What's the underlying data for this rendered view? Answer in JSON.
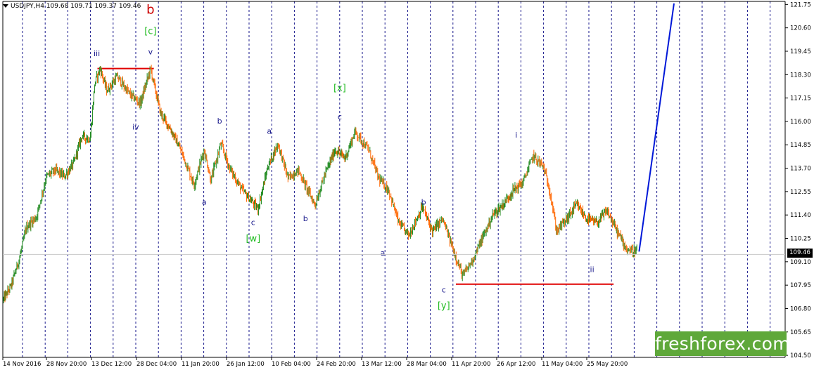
{
  "header": {
    "symbol_info": "USDJPY,H4  109.68 109.71 109.37 109.46"
  },
  "logo": {
    "text": "freshforex.com"
  },
  "current_price_label": "109.46",
  "colors": {
    "bear_candle": "#ff6600",
    "bull_candle": "#228b22",
    "forecast_line": "#0018d8",
    "level_line": "#e00000",
    "wave_blue": "#1a1a8c",
    "wave_green": "#22bb22",
    "wave_red": "#cc0000"
  },
  "chart_data": {
    "type": "candlestick",
    "title": "USDJPY,H4",
    "y_axis": {
      "min": 104.4,
      "max": 121.9,
      "ticks": [
        "121.75",
        "120.60",
        "119.45",
        "118.30",
        "117.15",
        "116.00",
        "114.85",
        "113.70",
        "112.55",
        "111.40",
        "110.25",
        "109.10",
        "107.95",
        "106.80",
        "105.65",
        "104.50"
      ]
    },
    "x_axis": {
      "ticks": [
        "14 Nov 2016",
        "28 Nov 20:00",
        "13 Dec 12:00",
        "28 Dec 04:00",
        "11 Jan 20:00",
        "26 Jan 12:00",
        "10 Feb 04:00",
        "24 Feb 20:00",
        "13 Mar 12:00",
        "28 Mar 04:00",
        "11 Apr 20:00",
        "26 Apr 12:00",
        "11 May 04:00",
        "25 May 20:00"
      ]
    },
    "grid": "vertical dashed",
    "path_points": [
      {
        "t": 0,
        "p": 107.2
      },
      {
        "t": 0.012,
        "p": 107.9
      },
      {
        "t": 0.025,
        "p": 109.3
      },
      {
        "t": 0.035,
        "p": 110.8
      },
      {
        "t": 0.05,
        "p": 111.3
      },
      {
        "t": 0.065,
        "p": 113.3
      },
      {
        "t": 0.078,
        "p": 113.6
      },
      {
        "t": 0.092,
        "p": 113.3
      },
      {
        "t": 0.105,
        "p": 113.9
      },
      {
        "t": 0.118,
        "p": 115.3
      },
      {
        "t": 0.13,
        "p": 115.1
      },
      {
        "t": 0.137,
        "p": 117.9
      },
      {
        "t": 0.145,
        "p": 118.6
      },
      {
        "t": 0.155,
        "p": 117.5
      },
      {
        "t": 0.17,
        "p": 118.2
      },
      {
        "t": 0.19,
        "p": 117.3
      },
      {
        "t": 0.205,
        "p": 116.9
      },
      {
        "t": 0.22,
        "p": 118.6
      },
      {
        "t": 0.235,
        "p": 116.4
      },
      {
        "t": 0.25,
        "p": 115.6
      },
      {
        "t": 0.265,
        "p": 114.6
      },
      {
        "t": 0.285,
        "p": 112.9
      },
      {
        "t": 0.3,
        "p": 114.6
      },
      {
        "t": 0.31,
        "p": 113.1
      },
      {
        "t": 0.325,
        "p": 114.9
      },
      {
        "t": 0.338,
        "p": 113.7
      },
      {
        "t": 0.355,
        "p": 112.7
      },
      {
        "t": 0.38,
        "p": 111.7
      },
      {
        "t": 0.395,
        "p": 113.8
      },
      {
        "t": 0.41,
        "p": 114.9
      },
      {
        "t": 0.425,
        "p": 113.2
      },
      {
        "t": 0.44,
        "p": 113.6
      },
      {
        "t": 0.465,
        "p": 111.9
      },
      {
        "t": 0.48,
        "p": 113.4
      },
      {
        "t": 0.495,
        "p": 114.6
      },
      {
        "t": 0.51,
        "p": 114.2
      },
      {
        "t": 0.525,
        "p": 115.5
      },
      {
        "t": 0.545,
        "p": 114.6
      },
      {
        "t": 0.56,
        "p": 113.2
      },
      {
        "t": 0.575,
        "p": 112.6
      },
      {
        "t": 0.59,
        "p": 111.0
      },
      {
        "t": 0.605,
        "p": 110.4
      },
      {
        "t": 0.625,
        "p": 111.8
      },
      {
        "t": 0.64,
        "p": 110.6
      },
      {
        "t": 0.655,
        "p": 111.2
      },
      {
        "t": 0.67,
        "p": 109.8
      },
      {
        "t": 0.685,
        "p": 108.4
      },
      {
        "t": 0.7,
        "p": 109.2
      },
      {
        "t": 0.715,
        "p": 110.3
      },
      {
        "t": 0.73,
        "p": 111.4
      },
      {
        "t": 0.745,
        "p": 111.9
      },
      {
        "t": 0.76,
        "p": 112.6
      },
      {
        "t": 0.775,
        "p": 113.0
      },
      {
        "t": 0.79,
        "p": 114.3
      },
      {
        "t": 0.805,
        "p": 113.8
      },
      {
        "t": 0.815,
        "p": 112.6
      },
      {
        "t": 0.825,
        "p": 110.6
      },
      {
        "t": 0.84,
        "p": 111.2
      },
      {
        "t": 0.855,
        "p": 111.9
      },
      {
        "t": 0.87,
        "p": 111.2
      },
      {
        "t": 0.885,
        "p": 111.0
      },
      {
        "t": 0.9,
        "p": 111.6
      },
      {
        "t": 0.915,
        "p": 110.6
      },
      {
        "t": 0.93,
        "p": 109.7
      },
      {
        "t": 0.945,
        "p": 109.6
      }
    ],
    "horizontal_levels": [
      {
        "price": 118.6,
        "t_start": 0.141,
        "t_end": 0.225
      },
      {
        "price": 108.0,
        "t_start": 0.675,
        "t_end": 0.91
      }
    ],
    "forecast_line": [
      {
        "t": 0.948,
        "p": 109.6
      },
      {
        "t": 1.0,
        "p": 121.8
      }
    ],
    "annotations": [
      {
        "text": "b",
        "t": 0.22,
        "p": 121.3,
        "color": "red",
        "size": "large"
      },
      {
        "text": "[c]",
        "t": 0.22,
        "p": 120.3,
        "color": "green"
      },
      {
        "text": "v",
        "t": 0.22,
        "p": 119.3,
        "color": "blue"
      },
      {
        "text": "iii",
        "t": 0.14,
        "p": 119.2,
        "color": "blue"
      },
      {
        "text": "iv",
        "t": 0.198,
        "p": 115.6,
        "color": "blue"
      },
      {
        "text": "b",
        "t": 0.323,
        "p": 115.9,
        "color": "blue"
      },
      {
        "text": "a",
        "t": 0.3,
        "p": 111.9,
        "color": "blue"
      },
      {
        "text": "c",
        "t": 0.373,
        "p": 110.9,
        "color": "blue"
      },
      {
        "text": "[w]",
        "t": 0.373,
        "p": 110.1,
        "color": "green"
      },
      {
        "text": "a",
        "t": 0.397,
        "p": 115.4,
        "color": "blue"
      },
      {
        "text": "b",
        "t": 0.451,
        "p": 111.1,
        "color": "blue"
      },
      {
        "text": "[x]",
        "t": 0.502,
        "p": 117.5,
        "color": "green"
      },
      {
        "text": "c",
        "t": 0.502,
        "p": 116.1,
        "color": "blue"
      },
      {
        "text": "a",
        "t": 0.566,
        "p": 109.4,
        "color": "blue"
      },
      {
        "text": "b",
        "t": 0.627,
        "p": 111.9,
        "color": "blue"
      },
      {
        "text": "c",
        "t": 0.657,
        "p": 107.6,
        "color": "blue"
      },
      {
        "text": "[y]",
        "t": 0.657,
        "p": 106.8,
        "color": "green"
      },
      {
        "text": "i",
        "t": 0.765,
        "p": 115.2,
        "color": "blue"
      },
      {
        "text": "ii",
        "t": 0.878,
        "p": 108.6,
        "color": "blue"
      }
    ]
  }
}
